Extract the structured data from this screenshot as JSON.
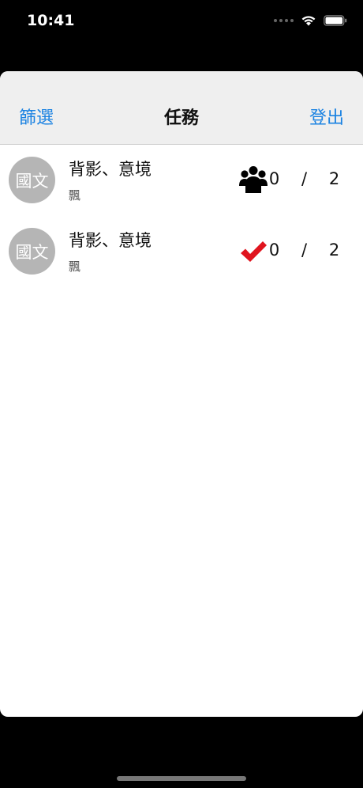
{
  "status_bar": {
    "time": "10:41"
  },
  "navbar": {
    "left_button": "篩選",
    "title": "任務",
    "right_button": "登出"
  },
  "tasks": [
    {
      "avatar_text": "國文",
      "title": "背影、意境",
      "subtitle": "飄",
      "icon": "group-icon",
      "done": "0",
      "separator": "/",
      "total": "2"
    },
    {
      "avatar_text": "國文",
      "title": "背影、意境",
      "subtitle": "飄",
      "icon": "checkmark-icon",
      "icon_color": "#e0141e",
      "done": "0",
      "separator": "/",
      "total": "2"
    }
  ],
  "colors": {
    "accent": "#1a82e2",
    "navbar_bg": "#efefef",
    "avatar_bg": "#b5b5b5"
  }
}
